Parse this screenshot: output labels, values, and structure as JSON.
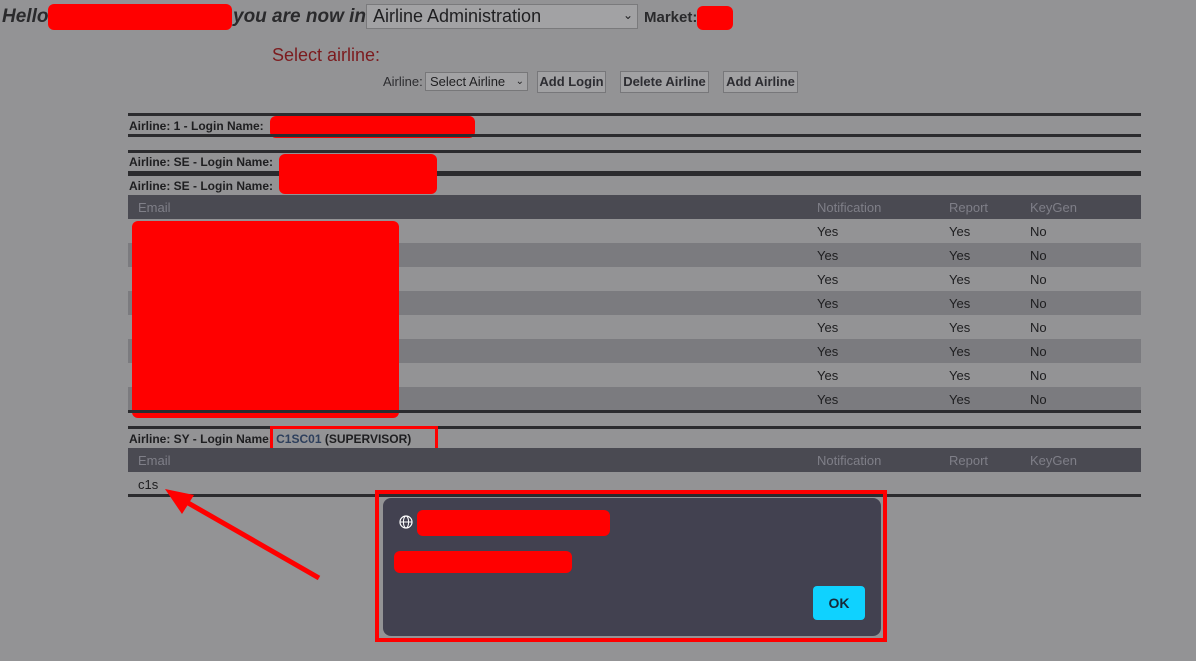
{
  "header": {
    "hello": "Hello",
    "you_are_now_in": "you are now in",
    "module_select_value": "Airline Administration",
    "market_label": "Market:"
  },
  "toolbar": {
    "select_airline_heading": "Select airline:",
    "airline_label": "Airline:",
    "airline_select_value": "Select Airline",
    "add_login": "Add Login",
    "delete_airline": "Delete Airline",
    "add_airline": "Add Airline"
  },
  "panels": {
    "p1_title": "Airline: 1 - Login Name:",
    "p2_title": "Airline: SE - Login Name:",
    "p3_title": "Airline: SE - Login Name:",
    "p4_title": "Airline: SY - Login Name:",
    "p4_code": "C1SC01",
    "p4_role": "(SUPERVISOR)"
  },
  "table_headers": {
    "email": "Email",
    "notification": "Notification",
    "report": "Report",
    "keygen": "KeyGen"
  },
  "se_rows": [
    {
      "notification": "Yes",
      "report": "Yes",
      "keygen": "No"
    },
    {
      "notification": "Yes",
      "report": "Yes",
      "keygen": "No"
    },
    {
      "notification": "Yes",
      "report": "Yes",
      "keygen": "No"
    },
    {
      "notification": "Yes",
      "report": "Yes",
      "keygen": "No"
    },
    {
      "notification": "Yes",
      "report": "Yes",
      "keygen": "No"
    },
    {
      "notification": "Yes",
      "report": "Yes",
      "keygen": "No"
    },
    {
      "notification": "Yes",
      "report": "Yes",
      "keygen": "No"
    },
    {
      "notification": "Yes",
      "report": "Yes",
      "keygen": "No"
    }
  ],
  "sy_rows": [
    {
      "email": "c1s"
    }
  ],
  "dialog": {
    "ok": "OK"
  },
  "colors": {
    "redaction": "#ff0000",
    "dialog_bg": "#424150",
    "ok_button": "#0fd2ff",
    "heading_red": "#7c1b1e"
  }
}
